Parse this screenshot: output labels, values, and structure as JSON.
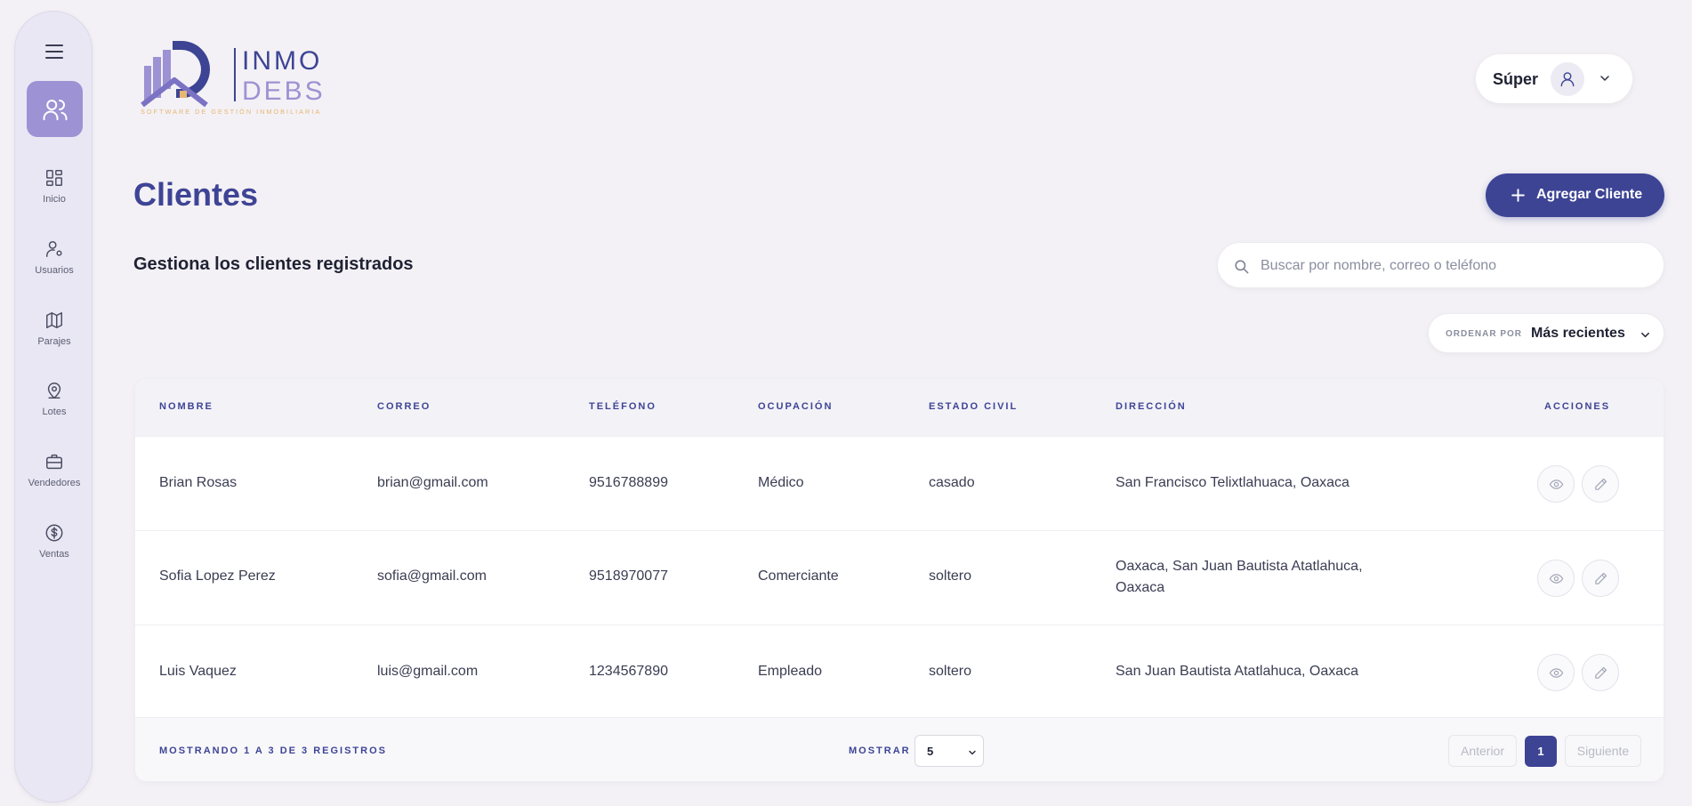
{
  "sidebar": {
    "items": [
      {
        "label": "Inicio",
        "icon": "dashboard-icon"
      },
      {
        "label": "Usuarios",
        "icon": "user-settings-icon"
      },
      {
        "label": "Parajes",
        "icon": "map-icon"
      },
      {
        "label": "Lotes",
        "icon": "map-pin-icon"
      },
      {
        "label": "Vendedores",
        "icon": "briefcase-icon"
      },
      {
        "label": "Ventas",
        "icon": "dollar-icon"
      }
    ]
  },
  "logo": {
    "line1": "INMO",
    "line2": "DEBS",
    "tagline": "SOFTWARE DE GESTIÓN INMOBILIARIA"
  },
  "user": {
    "name": "Súper"
  },
  "page": {
    "title": "Clientes",
    "subtitle": "Gestiona los clientes registrados",
    "add_label": "Agregar Cliente"
  },
  "search": {
    "placeholder": "Buscar por nombre, correo o teléfono"
  },
  "sort": {
    "label": "ORDENAR POR",
    "value": "Más recientes"
  },
  "table": {
    "headers": [
      "NOMBRE",
      "CORREO",
      "TELÉFONO",
      "OCUPACIÓN",
      "ESTADO CIVIL",
      "DIRECCIÓN",
      "ACCIONES"
    ],
    "rows": [
      {
        "nombre": "Brian Rosas",
        "correo": "brian@gmail.com",
        "telefono": "9516788899",
        "ocupacion": "Médico",
        "estado": "casado",
        "direccion1": "San Francisco Telixtlahuaca, Oaxaca",
        "direccion2": ""
      },
      {
        "nombre": "Sofia Lopez Perez",
        "correo": "sofia@gmail.com",
        "telefono": "9518970077",
        "ocupacion": "Comerciante",
        "estado": "soltero",
        "direccion1": "Oaxaca, San Juan Bautista Atatlahuca,",
        "direccion2": "Oaxaca"
      },
      {
        "nombre": "Luis Vaquez",
        "correo": "luis@gmail.com",
        "telefono": "1234567890",
        "ocupacion": "Empleado",
        "estado": "soltero",
        "direccion1": "San Juan Bautista Atatlahuca, Oaxaca",
        "direccion2": ""
      }
    ]
  },
  "footer": {
    "count": "MOSTRANDO 1 A 3 DE 3 REGISTROS",
    "show_label": "MOSTRAR",
    "page_size": "5",
    "prev": "Anterior",
    "current_page": "1",
    "next": "Siguiente"
  },
  "colors": {
    "accent": "#3d4494",
    "sidebar_active": "#9d92d3",
    "background": "#f3f1f5"
  }
}
